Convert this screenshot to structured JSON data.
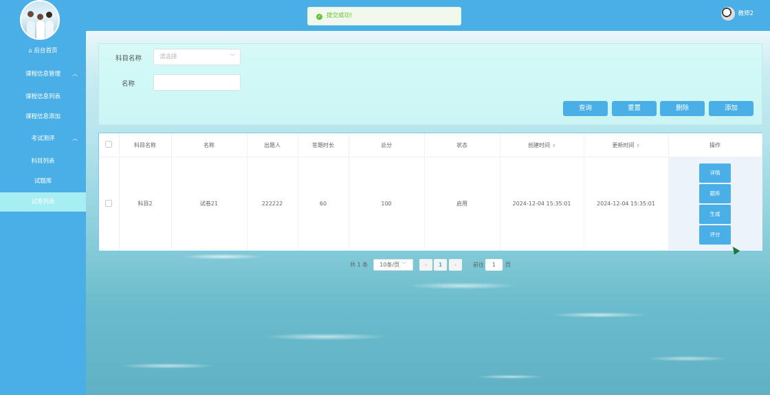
{
  "sidebar": {
    "items": [
      {
        "label": "后台首页"
      },
      {
        "label": "课程信息管理"
      },
      {
        "label": "课程信息列表"
      },
      {
        "label": "课程信息添加"
      },
      {
        "label": "考试测评"
      },
      {
        "label": "科目列表"
      },
      {
        "label": "试题库"
      },
      {
        "label": "试卷列表"
      }
    ],
    "active": "试卷列表"
  },
  "topbar": {
    "toast": "提交成功!",
    "user_name": "教师2"
  },
  "search": {
    "subject_label": "科目名称",
    "subject_placeholder": "请选择",
    "name_label": "名称",
    "name_value": "",
    "buttons": {
      "query": "查询",
      "reset": "重置",
      "delete": "删除",
      "add": "添加"
    }
  },
  "table": {
    "headers": [
      "科目名称",
      "名称",
      "出题人",
      "答题时长",
      "总分",
      "状态",
      "创建时间",
      "更新时间",
      "操作"
    ],
    "rows": [
      {
        "subject": "科目2",
        "name": "试卷21",
        "author": "222222",
        "duration": "60",
        "total": "100",
        "status": "启用",
        "created": "2024-12-04 15:35:01",
        "updated": "2024-12-04 15:35:01",
        "actions": [
          "详情",
          "题库",
          "生成",
          "评分"
        ]
      }
    ]
  },
  "pagination": {
    "total_text": "共 1 条",
    "page_size": "10条/页",
    "current_page": "1",
    "goto_label": "前往",
    "goto_value": "1",
    "page_unit": "页"
  },
  "colors": {
    "primary": "#4aafe6",
    "active_menu": "#a7eef2",
    "success": "#67c23a"
  }
}
